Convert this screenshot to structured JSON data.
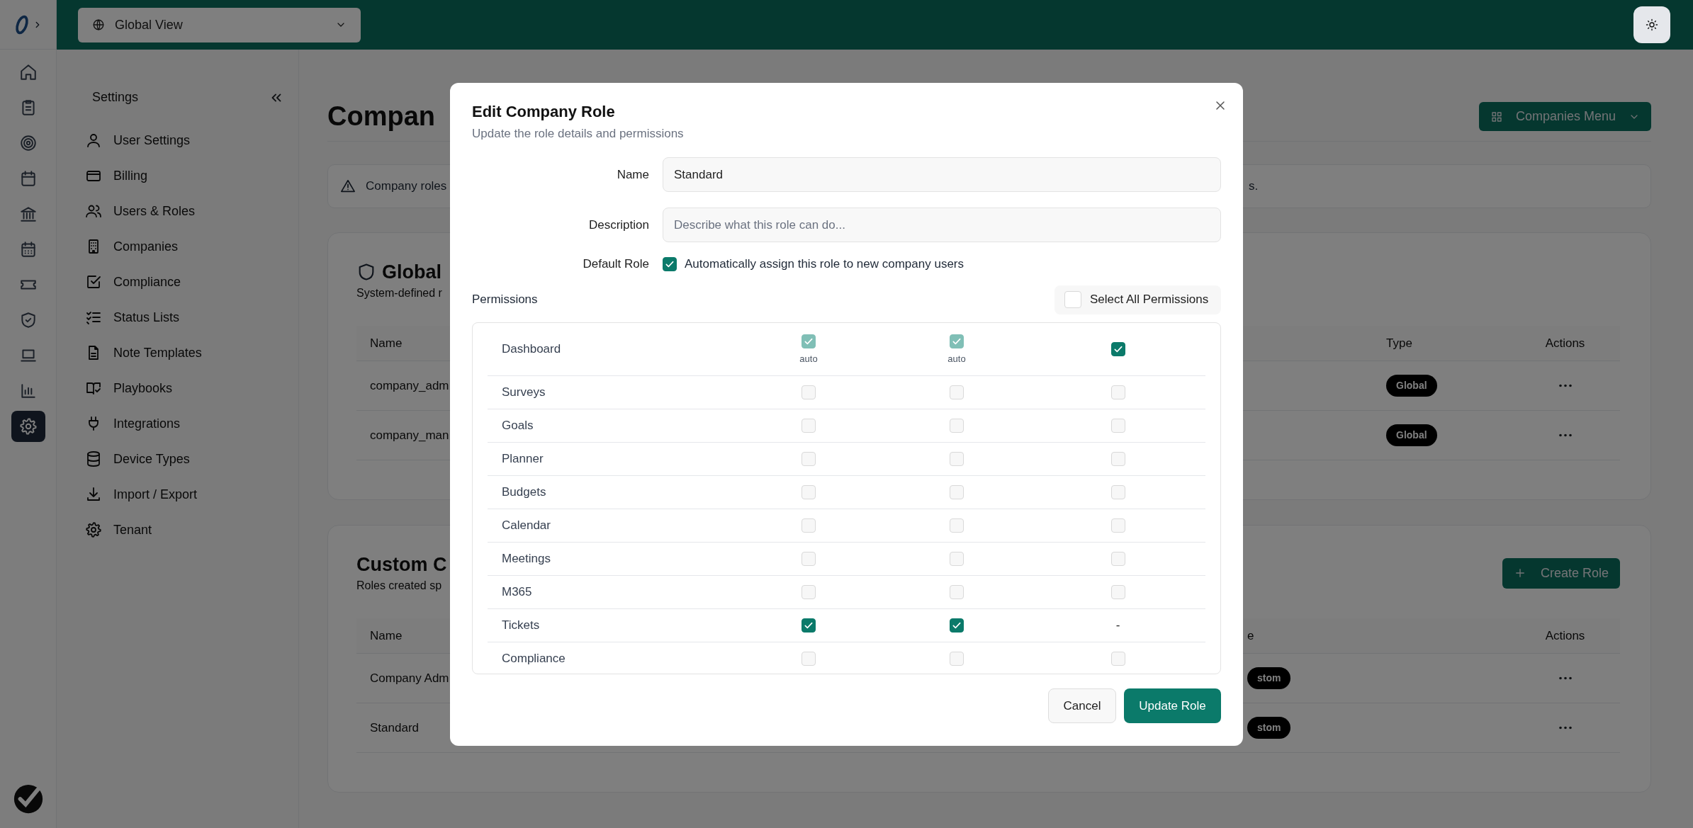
{
  "topbar": {
    "scope_select": "Global View"
  },
  "rail_items": [
    {
      "selected": false
    },
    {
      "selected": false
    },
    {
      "selected": false
    },
    {
      "selected": false
    },
    {
      "selected": false
    },
    {
      "selected": false
    },
    {
      "selected": false
    },
    {
      "selected": false
    },
    {
      "selected": false
    },
    {
      "selected": false
    },
    {
      "selected": true
    }
  ],
  "settings": {
    "title": "Settings",
    "items": [
      "User Settings",
      "Billing",
      "Users & Roles",
      "Companies",
      "Compliance",
      "Status Lists",
      "Note Templates",
      "Playbooks",
      "Integrations",
      "Device Types",
      "Import / Export",
      "Tenant"
    ]
  },
  "page": {
    "title": "Compan",
    "menu_button": "Companies Menu",
    "notice": [
      "Company roles",
      "s."
    ]
  },
  "global_roles": {
    "title": "Global",
    "subtitle": "System-defined r",
    "columns": [
      "Name",
      "Type",
      "Actions"
    ],
    "rows": [
      {
        "name": "company_adm",
        "type": "Global"
      },
      {
        "name": "company_man",
        "type": "Global"
      }
    ]
  },
  "custom_roles": {
    "title": "Custom C",
    "subtitle": "Roles created sp",
    "create_button": "Create Role",
    "columns": [
      "Name",
      "e",
      "Actions"
    ],
    "rows": [
      {
        "name": "Company Adm",
        "type": "stom"
      },
      {
        "name": "Standard",
        "type": "stom"
      }
    ]
  },
  "modal": {
    "title": "Edit Company Role",
    "subtitle": "Update the role details and permissions",
    "fields": [
      {
        "label": "Name",
        "value": "Standard"
      },
      {
        "label": "Description",
        "placeholder": "Describe what this role can do..."
      }
    ],
    "default_role": {
      "label": "Default Role",
      "checked": true,
      "text": "Automatically assign this role to new company users"
    },
    "permissions_label": "Permissions",
    "select_all": {
      "label": "Select All Permissions",
      "checked": false
    },
    "permissions": [
      {
        "name": "Dashboard",
        "cells": [
          {
            "kind": "auto",
            "checked": true,
            "note": "auto"
          },
          {
            "kind": "auto",
            "checked": true,
            "note": "auto"
          },
          {
            "kind": "checkbox",
            "checked": true
          }
        ]
      },
      {
        "name": "Surveys",
        "cells": [
          {
            "kind": "checkbox",
            "checked": false
          },
          {
            "kind": "checkbox",
            "checked": false
          },
          {
            "kind": "checkbox",
            "checked": false
          }
        ]
      },
      {
        "name": "Goals",
        "cells": [
          {
            "kind": "checkbox",
            "checked": false
          },
          {
            "kind": "checkbox",
            "checked": false
          },
          {
            "kind": "checkbox",
            "checked": false
          }
        ]
      },
      {
        "name": "Planner",
        "cells": [
          {
            "kind": "checkbox",
            "checked": false
          },
          {
            "kind": "checkbox",
            "checked": false
          },
          {
            "kind": "checkbox",
            "checked": false
          }
        ]
      },
      {
        "name": "Budgets",
        "cells": [
          {
            "kind": "checkbox",
            "checked": false
          },
          {
            "kind": "checkbox",
            "checked": false
          },
          {
            "kind": "checkbox",
            "checked": false
          }
        ]
      },
      {
        "name": "Calendar",
        "cells": [
          {
            "kind": "checkbox",
            "checked": false
          },
          {
            "kind": "checkbox",
            "checked": false
          },
          {
            "kind": "checkbox",
            "checked": false
          }
        ]
      },
      {
        "name": "Meetings",
        "cells": [
          {
            "kind": "checkbox",
            "checked": false
          },
          {
            "kind": "checkbox",
            "checked": false
          },
          {
            "kind": "checkbox",
            "checked": false
          }
        ]
      },
      {
        "name": "M365",
        "cells": [
          {
            "kind": "checkbox",
            "checked": false
          },
          {
            "kind": "checkbox",
            "checked": false
          },
          {
            "kind": "checkbox",
            "checked": false
          }
        ]
      },
      {
        "name": "Tickets",
        "cells": [
          {
            "kind": "checkbox",
            "checked": true
          },
          {
            "kind": "checkbox",
            "checked": true
          },
          {
            "kind": "dash",
            "text": "-"
          }
        ]
      },
      {
        "name": "Compliance",
        "cells": [
          {
            "kind": "checkbox",
            "checked": false
          },
          {
            "kind": "checkbox",
            "checked": false
          },
          {
            "kind": "checkbox",
            "checked": false
          }
        ]
      }
    ],
    "buttons": {
      "cancel": "Cancel",
      "submit": "Update Role"
    }
  }
}
